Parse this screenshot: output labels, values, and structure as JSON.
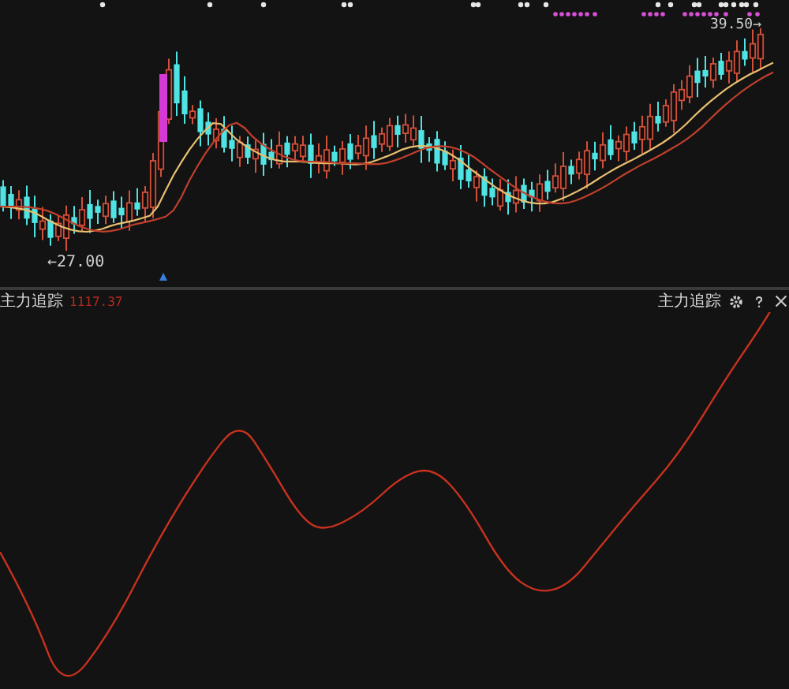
{
  "price_panel": {
    "low_label": "←27.00",
    "high_label": "39.50→"
  },
  "indicator_panel": {
    "left_title": "主力追踪",
    "value": "1117.37",
    "right_title": "主力追踪"
  }
}
